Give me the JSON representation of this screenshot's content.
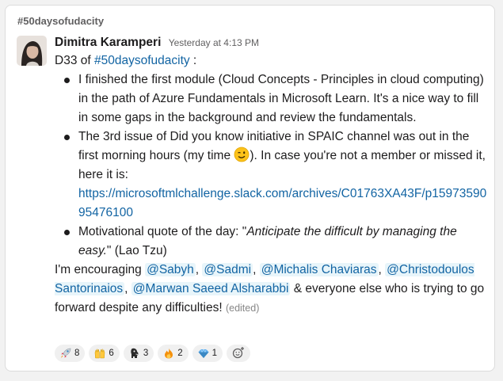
{
  "channel": "#50daysofudacity",
  "message": {
    "author": "Dimitra Karamperi",
    "timestamp": "Yesterday at 4:13 PM",
    "intro_prefix": "D33 of ",
    "intro_hashtag": "#50daysofudacity",
    "intro_suffix": " :",
    "bullet1": "I finished the first module (Cloud Concepts - Principles in cloud computing) in the path of Azure Fundamentals in Microsoft Learn. It's a nice way to fill in some gaps in the background and review the fundamentals.",
    "bullet2_text": "The 3rd issue of Did you know initiative in SPAIC channel was out in the first morning hours (my time ",
    "bullet2_after": "). In case you're not a member or missed it, here it is:",
    "bullet2_link": "https://microsoftmlchallenge.slack.com/archives/C01763XA43F/p1597359095476100",
    "bullet3_prefix": "Motivational quote of the day: \"",
    "bullet3_quote": "Anticipate the difficult by managing the easy.",
    "bullet3_suffix": "\" (Lao Tzu)",
    "closing_prefix": "I'm encouraging ",
    "mentions": [
      "@Sabyh",
      "@Sadmi",
      "@Michalis Chaviaras",
      "@Christodoulos Santorinaios",
      "@Marwan Saeed Alsharabbi"
    ],
    "closing_suffix": " & everyone else who is trying to go forward despite any difficulties! ",
    "edited_label": "(edited)"
  },
  "reactions": [
    {
      "icon": "rocket-icon",
      "count": "8"
    },
    {
      "icon": "raised-hands-icon",
      "count": "6"
    },
    {
      "icon": "mascot-icon",
      "count": "3"
    },
    {
      "icon": "fire-icon",
      "count": "2"
    },
    {
      "icon": "gem-icon",
      "count": "1"
    }
  ],
  "colors": {
    "link": "#1264a3",
    "mention_bg": "#e8f5fa",
    "text": "#1d1c1d",
    "muted": "#616061"
  }
}
